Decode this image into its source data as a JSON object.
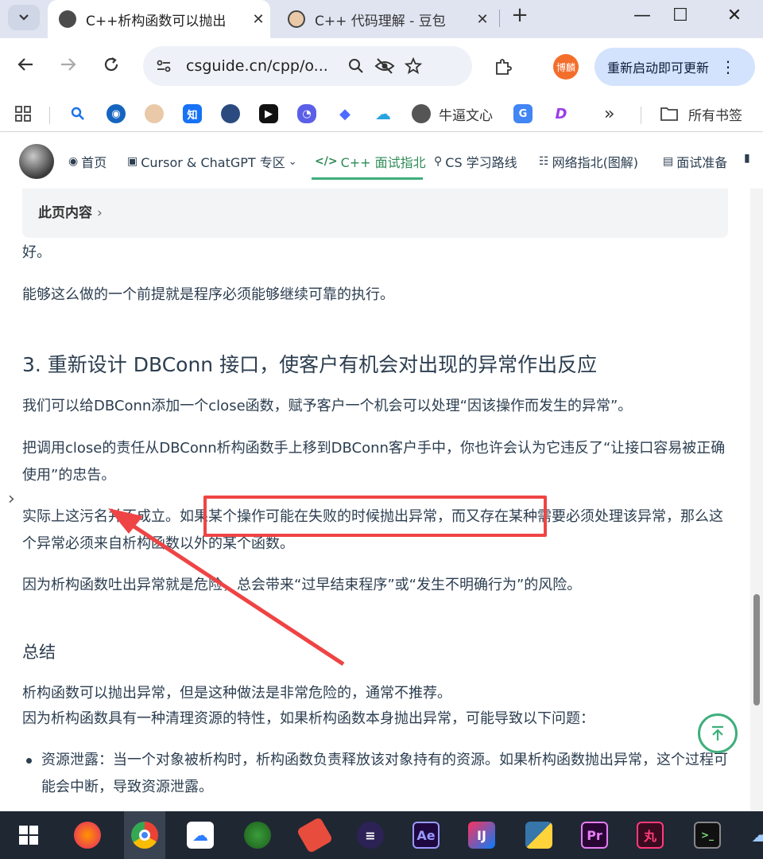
{
  "tabs": [
    {
      "title": "C++析构函数可以抛出",
      "close": "✕"
    },
    {
      "title": "C++ 代码理解 - 豆包",
      "close": "✕"
    }
  ],
  "window_controls": {
    "minimize": "—",
    "maximize": "☐",
    "close": "✕",
    "new_tab": "+"
  },
  "address_bar": {
    "url": "csguide.cn/cpp/o..."
  },
  "profile": {
    "label": "博麟"
  },
  "update_button": {
    "label": "重新启动即可更新",
    "menu": "⋮"
  },
  "bookmarks": {
    "items": [
      {
        "label": "牛逼文心"
      }
    ],
    "more": "»",
    "all_bookmarks": "所有书签"
  },
  "site_nav": {
    "items": [
      {
        "icon": "compass-icon",
        "label": "首页"
      },
      {
        "icon": "robot-icon",
        "label": "Cursor & ChatGPT 专区",
        "caret": "⌄"
      },
      {
        "icon": "code-icon",
        "label": "C++ 面试指北",
        "active": true
      },
      {
        "icon": "route-icon",
        "label": "CS 学习路线"
      },
      {
        "icon": "network-icon",
        "label": "网络指北(图解)"
      },
      {
        "icon": "doc-icon",
        "label": "面试准备"
      }
    ]
  },
  "toc": {
    "label": "此页内容",
    "chevron": "›"
  },
  "article": {
    "p_good": "好。",
    "p_premise": "能够这么做的一个前提就是程序必须能够继续可靠的执行。",
    "h3": "3. 重新设计 DBConn 接口，使客户有机会对出现的异常作出反应",
    "p1": "我们可以给DBConn添加一个close函数，赋予客户一个机会可以处理“因该操作而发生的异常”。",
    "p2": "把调用close的责任从DBConn析构函数手上移到DBConn客户手中，你也许会认为它违反了“让接口容易被正确使用”的忠告。",
    "p3": "实际上这污名并不成立。如果某个操作可能在失败的时候抛出异常，而又存在某种需要必须处理该异常，那么这个异常必须来自析构函数以外的某个函数。",
    "p4": "因为析构函数吐出异常就是危险，总会带来“过早结束程序”或“发生不明确行为”的风险。",
    "summary_heading": "总结",
    "s1": "析构函数可以抛出异常，但是这种做法是非常危险的，通常不推荐。",
    "s2": "因为析构函数具有一种清理资源的特性，如果析构函数本身抛出异常，可能导致以下问题：",
    "bullet1": "资源泄露：当一个对象被析构时，析构函数负责释放该对象持有的资源。如果析构函数抛出异常，这个过程可能会中断，导致资源泄露。"
  },
  "colors": {
    "accent": "#3eaf7c",
    "annotation": "#ef4444",
    "text": "#2c3e50"
  }
}
